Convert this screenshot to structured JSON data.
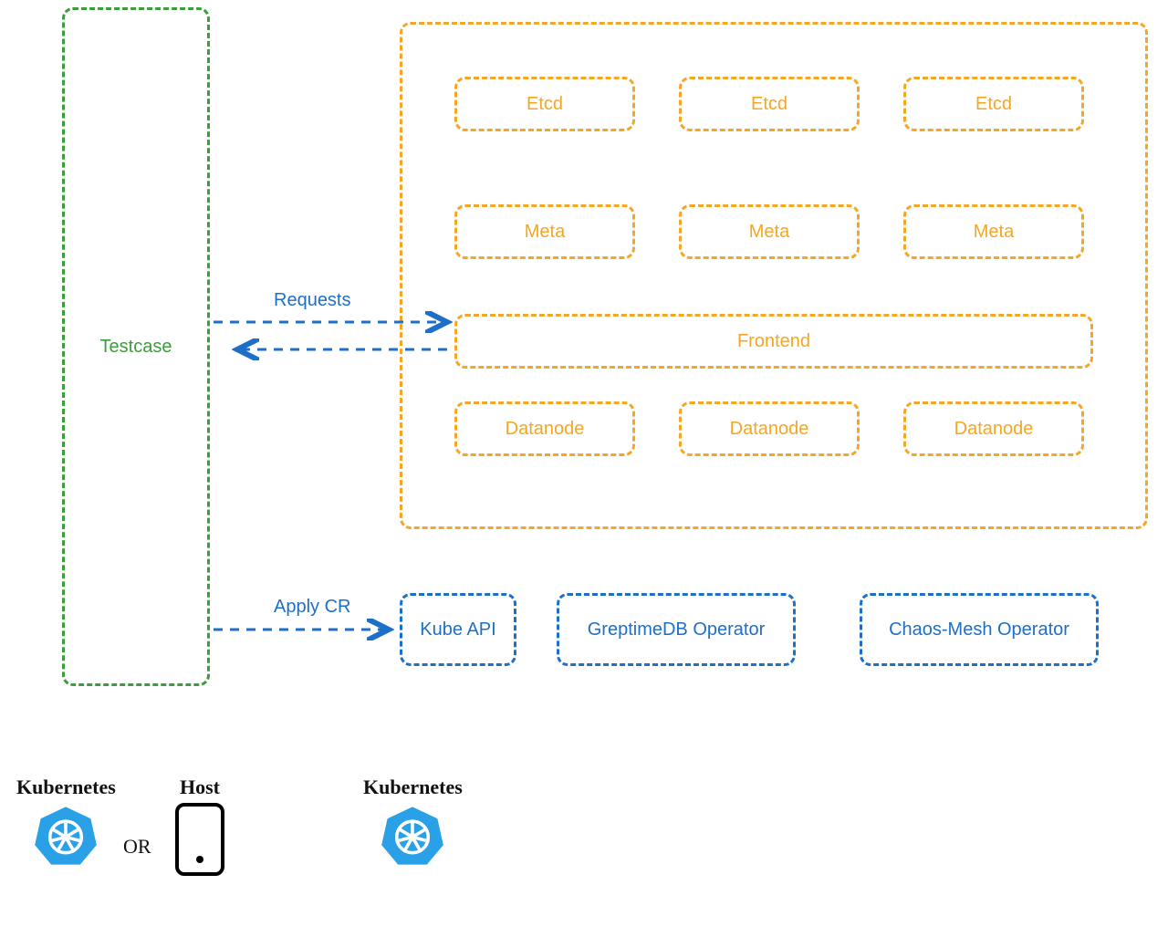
{
  "testcase": {
    "label": "Testcase"
  },
  "cluster": {
    "rows": {
      "etcd": [
        "Etcd",
        "Etcd",
        "Etcd"
      ],
      "meta": [
        "Meta",
        "Meta",
        "Meta"
      ],
      "frontend": "Frontend",
      "datanode": [
        "Datanode",
        "Datanode",
        "Datanode"
      ]
    }
  },
  "arrows": {
    "requests": "Requests",
    "apply_cr": "Apply CR"
  },
  "controllers": {
    "kubeapi": "Kube API",
    "greptimedb": "GreptimeDB Operator",
    "chaosmesh": "Chaos-Mesh Operator"
  },
  "footer": {
    "k8s1": "Kubernetes",
    "or": "OR",
    "host": "Host",
    "k8s2": "Kubernetes"
  },
  "colors": {
    "green": "#3a9e3a",
    "orange": "#f5a623",
    "blue": "#1e6fc7",
    "k8s_blue": "#2aa1e6"
  }
}
